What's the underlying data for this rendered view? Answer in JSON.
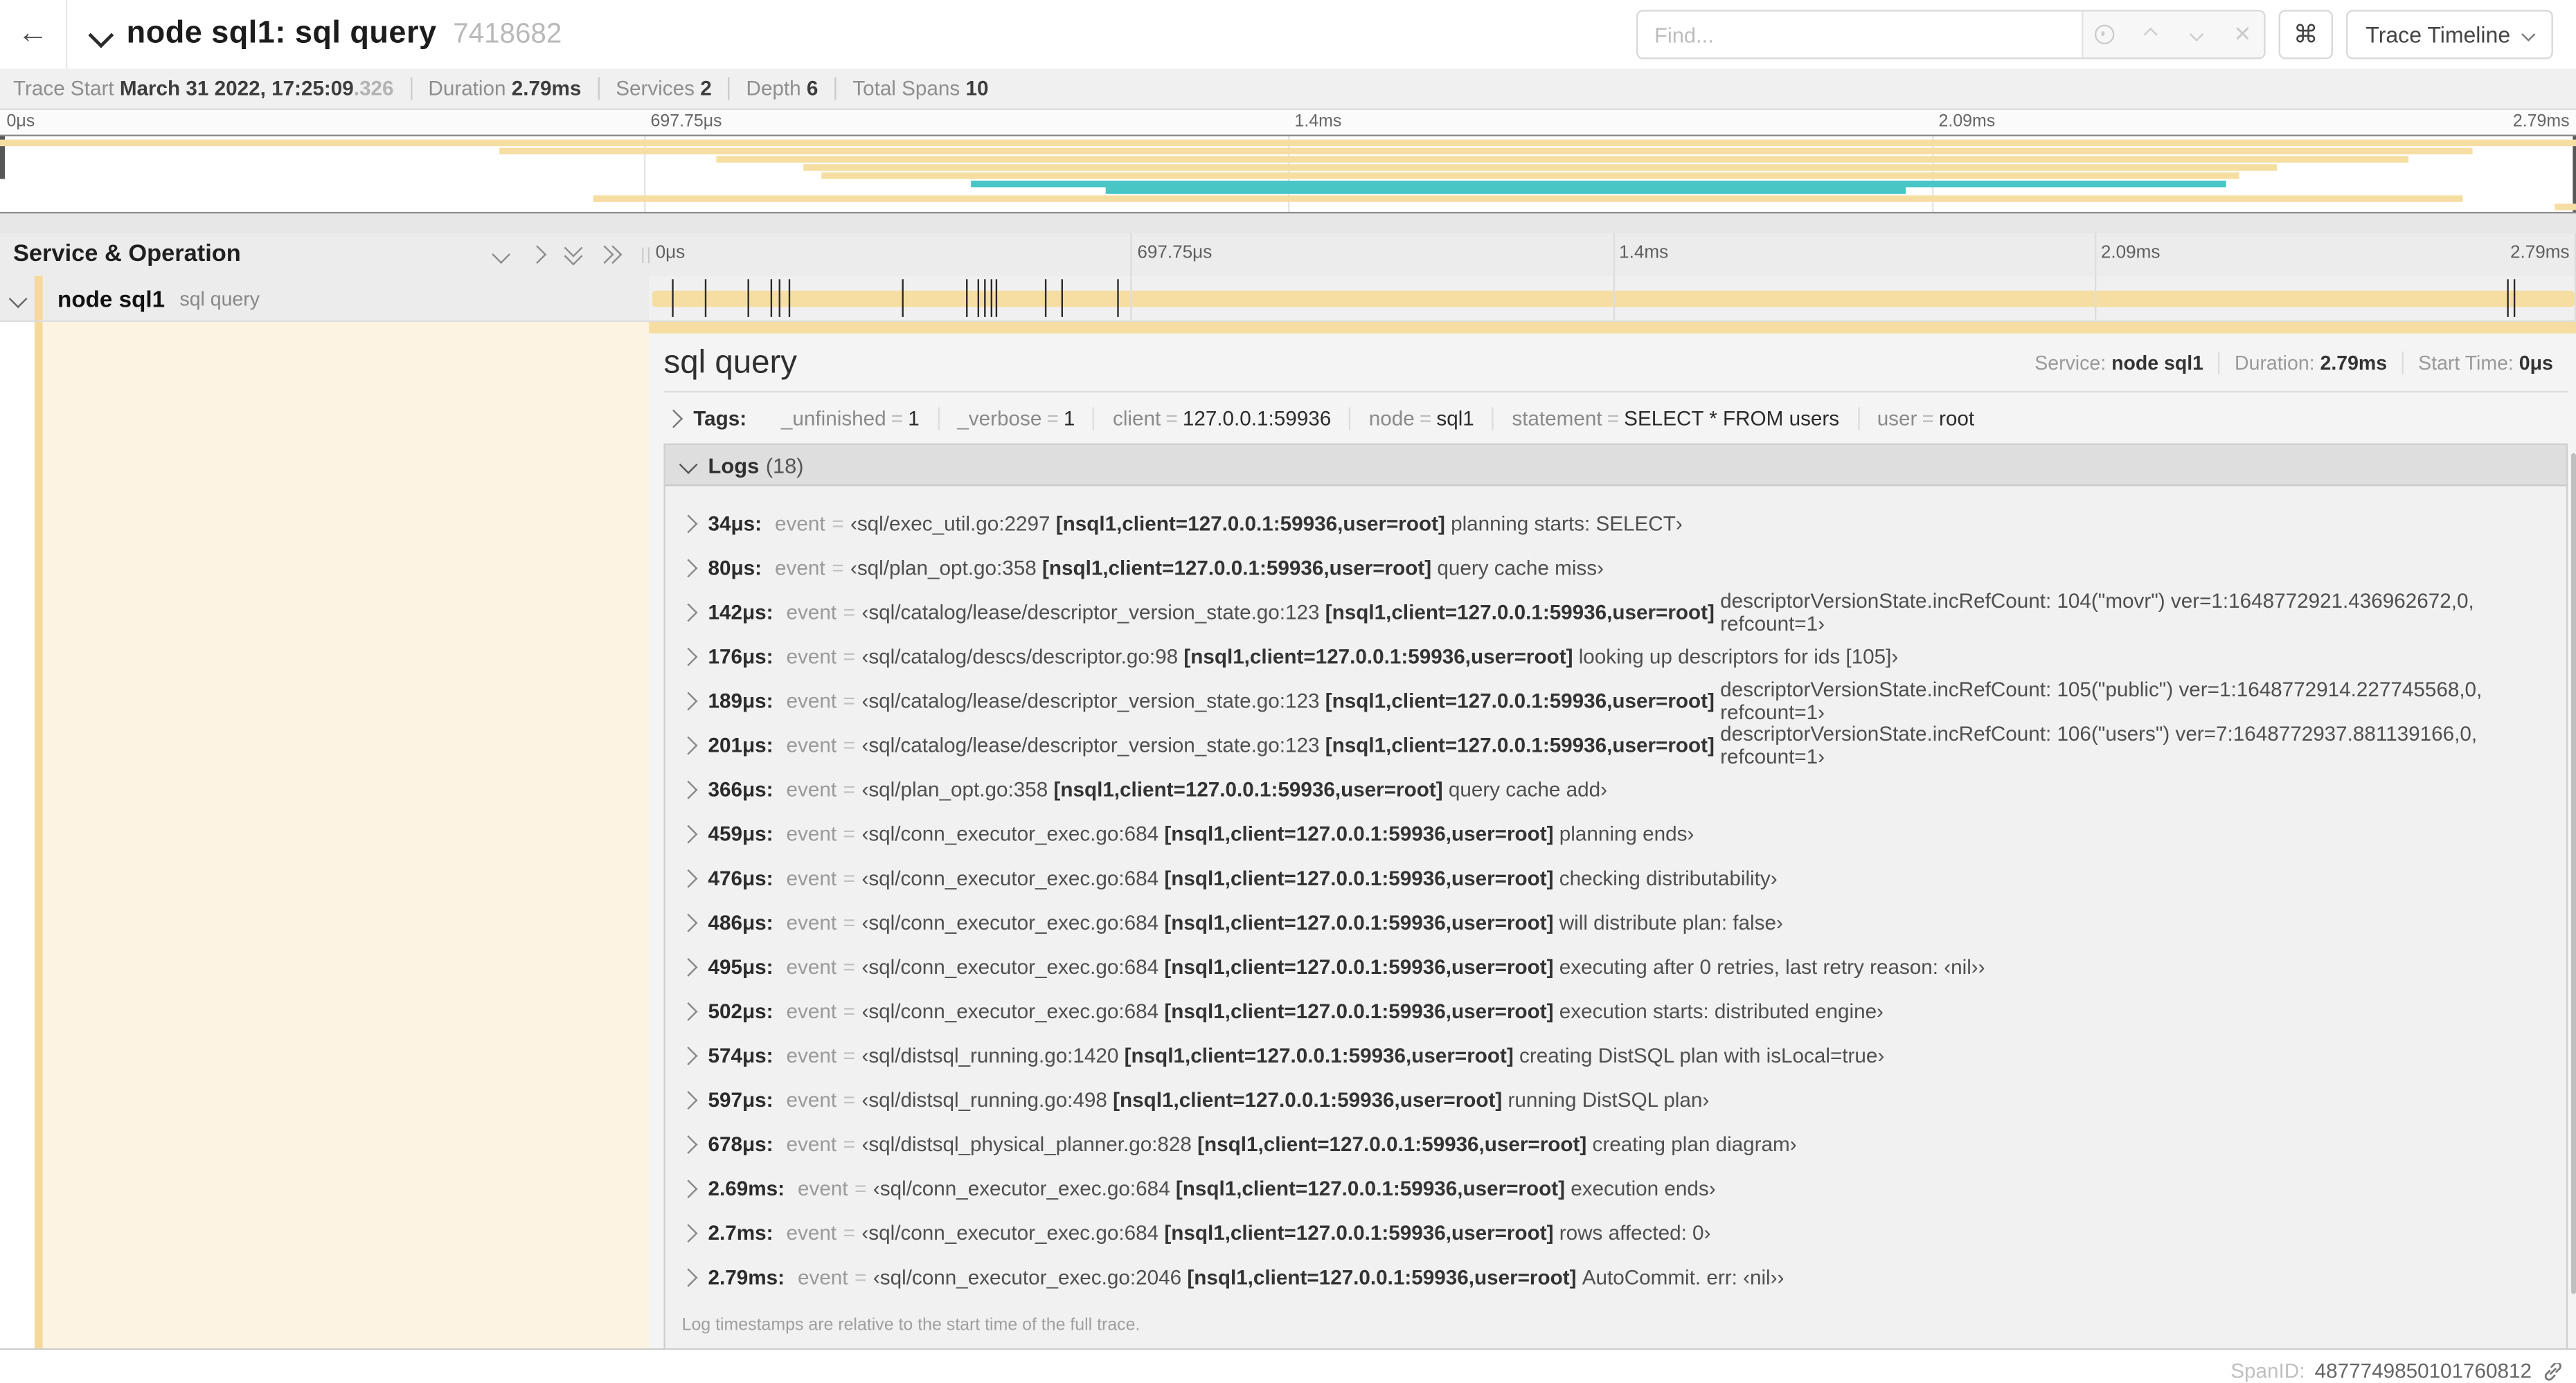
{
  "header": {
    "title": "node sql1: sql query",
    "trace_id_short": "7418682",
    "find_placeholder": "Find...",
    "shortcut_button": "⌘",
    "view_dropdown_label": "Trace Timeline",
    "back_arrow": "←"
  },
  "stats": {
    "trace_start_label": "Trace Start",
    "trace_start_value": "March 31 2022, 17:25:09",
    "trace_start_fraction": ".326",
    "duration_label": "Duration",
    "duration_value": "2.79ms",
    "services_label": "Services",
    "services_value": "2",
    "depth_label": "Depth",
    "depth_value": "6",
    "total_spans_label": "Total Spans",
    "total_spans_value": "10"
  },
  "grid": {
    "left_header": "Service & Operation",
    "resizer_grip": "||"
  },
  "row": {
    "service": "node sql1",
    "operation": "sql query"
  },
  "detail": {
    "title": "sql query",
    "service_label": "Service:",
    "service_value": "node sql1",
    "duration_label": "Duration:",
    "duration_value": "2.79ms",
    "start_label": "Start Time:",
    "start_value": "0μs",
    "span_id_label": "SpanID:",
    "span_id_value": "4877749850101760812"
  },
  "tags": {
    "label": "Tags:",
    "items": [
      {
        "key": "_unfinished",
        "value": "1"
      },
      {
        "key": "_verbose",
        "value": "1"
      },
      {
        "key": "client",
        "value": "127.0.0.1:59936"
      },
      {
        "key": "node",
        "value": "sql1"
      },
      {
        "key": "statement",
        "value": "SELECT * FROM users"
      },
      {
        "key": "user",
        "value": "root"
      }
    ]
  },
  "logs": {
    "label": "Logs",
    "count": "(18)",
    "field_label": "event",
    "footer": "Log timestamps are relative to the start time of the full trace.",
    "entries": [
      {
        "t": "34μs:",
        "src": "‹sql/exec_util.go:2297",
        "ctx": "[nsql1,client=127.0.0.1:59936,user=root]",
        "text": "planning starts: SELECT›"
      },
      {
        "t": "80μs:",
        "src": "‹sql/plan_opt.go:358",
        "ctx": "[nsql1,client=127.0.0.1:59936,user=root]",
        "text": "query cache miss›"
      },
      {
        "t": "142μs:",
        "src": "‹sql/catalog/lease/descriptor_version_state.go:123",
        "ctx": "[nsql1,client=127.0.0.1:59936,user=root]",
        "text": "descriptorVersionState.incRefCount: 104(\"movr\") ver=1:1648772921.436962672,0, refcount=1›"
      },
      {
        "t": "176μs:",
        "src": "‹sql/catalog/descs/descriptor.go:98",
        "ctx": "[nsql1,client=127.0.0.1:59936,user=root]",
        "text": "looking up descriptors for ids [105]›"
      },
      {
        "t": "189μs:",
        "src": "‹sql/catalog/lease/descriptor_version_state.go:123",
        "ctx": "[nsql1,client=127.0.0.1:59936,user=root]",
        "text": "descriptorVersionState.incRefCount: 105(\"public\") ver=1:1648772914.227745568,0, refcount=1›"
      },
      {
        "t": "201μs:",
        "src": "‹sql/catalog/lease/descriptor_version_state.go:123",
        "ctx": "[nsql1,client=127.0.0.1:59936,user=root]",
        "text": "descriptorVersionState.incRefCount: 106(\"users\") ver=7:1648772937.881139166,0, refcount=1›"
      },
      {
        "t": "366μs:",
        "src": "‹sql/plan_opt.go:358",
        "ctx": "[nsql1,client=127.0.0.1:59936,user=root]",
        "text": "query cache add›"
      },
      {
        "t": "459μs:",
        "src": "‹sql/conn_executor_exec.go:684",
        "ctx": "[nsql1,client=127.0.0.1:59936,user=root]",
        "text": "planning ends›"
      },
      {
        "t": "476μs:",
        "src": "‹sql/conn_executor_exec.go:684",
        "ctx": "[nsql1,client=127.0.0.1:59936,user=root]",
        "text": "checking distributability›"
      },
      {
        "t": "486μs:",
        "src": "‹sql/conn_executor_exec.go:684",
        "ctx": "[nsql1,client=127.0.0.1:59936,user=root]",
        "text": "will distribute plan: false›"
      },
      {
        "t": "495μs:",
        "src": "‹sql/conn_executor_exec.go:684",
        "ctx": "[nsql1,client=127.0.0.1:59936,user=root]",
        "text": "executing after 0 retries, last retry reason: ‹nil››"
      },
      {
        "t": "502μs:",
        "src": "‹sql/conn_executor_exec.go:684",
        "ctx": "[nsql1,client=127.0.0.1:59936,user=root]",
        "text": "execution starts: distributed engine›"
      },
      {
        "t": "574μs:",
        "src": "‹sql/distsql_running.go:1420",
        "ctx": "[nsql1,client=127.0.0.1:59936,user=root]",
        "text": "creating DistSQL plan with isLocal=true›"
      },
      {
        "t": "597μs:",
        "src": "‹sql/distsql_running.go:498",
        "ctx": "[nsql1,client=127.0.0.1:59936,user=root]",
        "text": "running DistSQL plan›"
      },
      {
        "t": "678μs:",
        "src": "‹sql/distsql_physical_planner.go:828",
        "ctx": "[nsql1,client=127.0.0.1:59936,user=root]",
        "text": "creating plan diagram›"
      },
      {
        "t": "2.69ms:",
        "src": "‹sql/conn_executor_exec.go:684",
        "ctx": "[nsql1,client=127.0.0.1:59936,user=root]",
        "text": "execution ends›"
      },
      {
        "t": "2.7ms:",
        "src": "‹sql/conn_executor_exec.go:684",
        "ctx": "[nsql1,client=127.0.0.1:59936,user=root]",
        "text": "rows affected: 0›"
      },
      {
        "t": "2.79ms:",
        "src": "‹sql/conn_executor_exec.go:2046",
        "ctx": "[nsql1,client=127.0.0.1:59936,user=root]",
        "text": "AutoCommit. err: ‹nil››"
      }
    ]
  },
  "colors": {
    "span_orange": "#F6DEA2",
    "span_teal": "#48C5C5",
    "expanded_cream": "#FDF3E3",
    "stripe_tan": "#F5D99C"
  },
  "chart_data": {
    "type": "timeline",
    "title": "Trace minimap and span timeline",
    "total_duration_ms": 2.79,
    "axis_ticks": [
      "0μs",
      "697.75μs",
      "1.4ms",
      "2.09ms",
      "2.79ms"
    ],
    "root_span": {
      "service": "node sql1",
      "operation": "sql query",
      "start_pct": 0,
      "end_pct": 100,
      "color": "orange"
    },
    "minimap_spans": [
      {
        "start_pct": 0,
        "end_pct": 100,
        "color": "orange"
      },
      {
        "start_pct": 19.4,
        "end_pct": 96,
        "color": "orange"
      },
      {
        "start_pct": 27.8,
        "end_pct": 93.5,
        "color": "orange"
      },
      {
        "start_pct": 31.2,
        "end_pct": 88.4,
        "color": "orange"
      },
      {
        "start_pct": 31.9,
        "end_pct": 86.9,
        "color": "orange"
      },
      {
        "start_pct": 37.7,
        "end_pct": 86.4,
        "color": "teal"
      },
      {
        "start_pct": 42.9,
        "end_pct": 74,
        "color": "teal"
      },
      {
        "start_pct": 23,
        "end_pct": 95.6,
        "color": "orange"
      },
      {
        "start_pct": 99.2,
        "end_pct": 100,
        "color": "orange"
      }
    ],
    "log_marks_us": [
      34,
      80,
      142,
      176,
      189,
      201,
      366,
      459,
      476,
      486,
      495,
      502,
      574,
      597,
      678,
      2690,
      2700,
      2790
    ],
    "total_us": 2790
  }
}
